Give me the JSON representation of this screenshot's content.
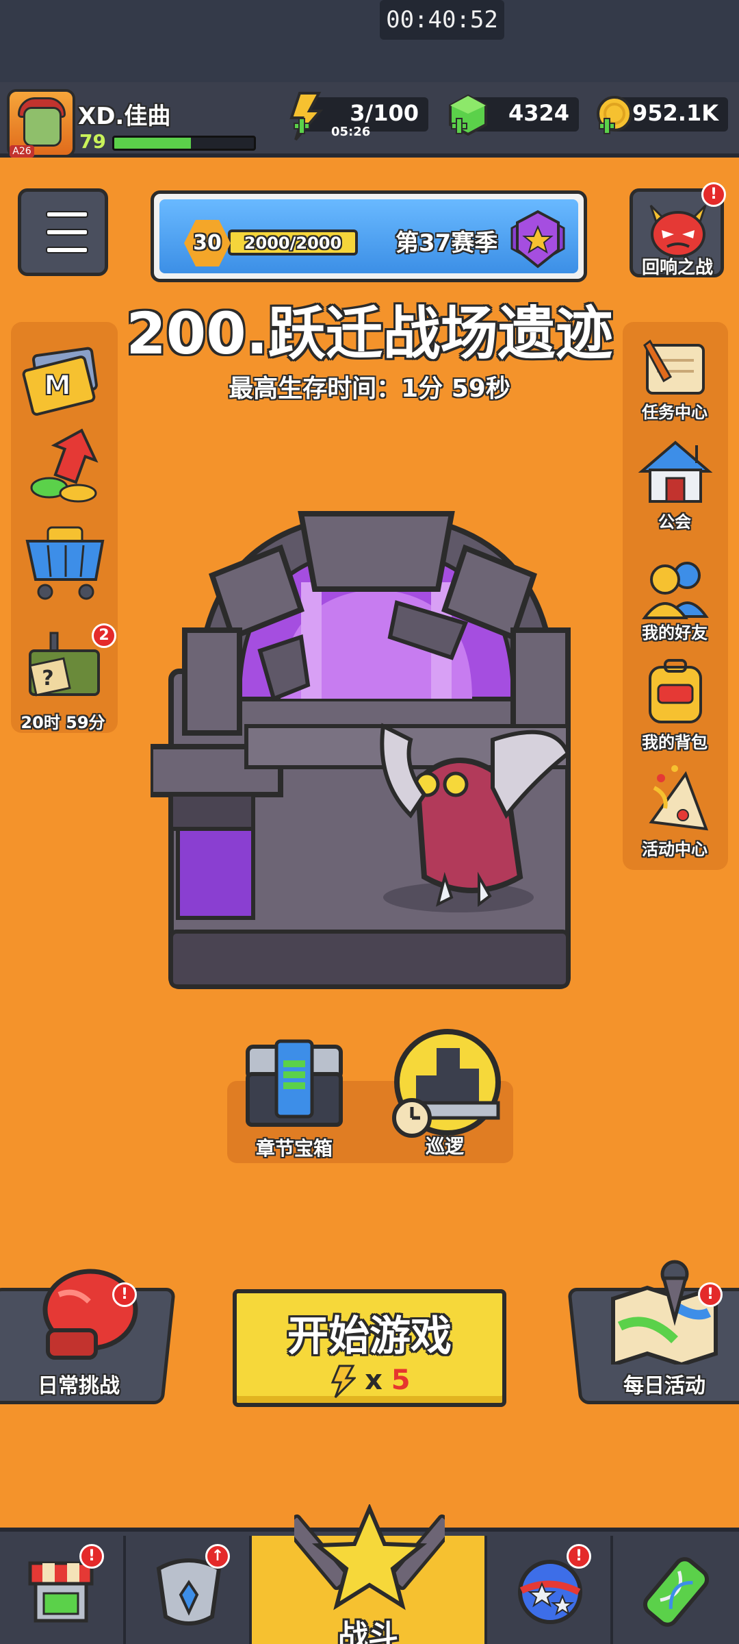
{
  "status_bar": {
    "time": "00:40:52"
  },
  "player": {
    "name": "XD.佳曲",
    "level": "79",
    "avatar_tag": "A26",
    "xp_fraction": 0.55
  },
  "resources": {
    "energy": {
      "value": "3/100",
      "timer": "05:26"
    },
    "gems": {
      "value": "4324"
    },
    "coins": {
      "value": "952.1K"
    }
  },
  "season": {
    "level": "30",
    "progress": "2000/2000",
    "progress_fraction": 1.0,
    "name": "第37赛季"
  },
  "echo_battle": {
    "label": "回响之战",
    "badge": "!"
  },
  "stage": {
    "title": "200.跃迁战场遗迹",
    "best_survival": "最高生存时间：1分 59秒"
  },
  "left_sidebar": {
    "items": [
      {
        "id": "monthly-card"
      },
      {
        "id": "growth-fund"
      },
      {
        "id": "shop-cart"
      },
      {
        "id": "supply-crate",
        "label": "20时 59分",
        "badge": "2"
      }
    ]
  },
  "right_sidebar": {
    "items": [
      {
        "id": "tasks",
        "label": "任务中心"
      },
      {
        "id": "guild",
        "label": "公会"
      },
      {
        "id": "friends",
        "label": "我的好友"
      },
      {
        "id": "backpack",
        "label": "我的背包"
      },
      {
        "id": "events",
        "label": "活动中心"
      }
    ]
  },
  "chapter_chest": {
    "label": "章节宝箱"
  },
  "patrol": {
    "label": "巡逻"
  },
  "daily_challenge": {
    "label": "日常挑战",
    "badge": "!"
  },
  "daily_activity": {
    "label": "每日活动",
    "badge": "!"
  },
  "start_button": {
    "label": "开始游戏",
    "cost_x": "x",
    "cost_value": "5"
  },
  "bottom_nav": {
    "tabs": [
      {
        "id": "shop",
        "badge": "!"
      },
      {
        "id": "equipment",
        "badge": "↑"
      },
      {
        "id": "battle",
        "label": "战斗"
      },
      {
        "id": "skills",
        "badge": "!"
      },
      {
        "id": "evolution"
      }
    ]
  },
  "colors": {
    "background": "#f4932b",
    "panel_dark": "#3b3f4d",
    "start_yellow": "#f6d83a",
    "badge_red": "#e42a2a",
    "portal_purple": "#a54ee0"
  }
}
